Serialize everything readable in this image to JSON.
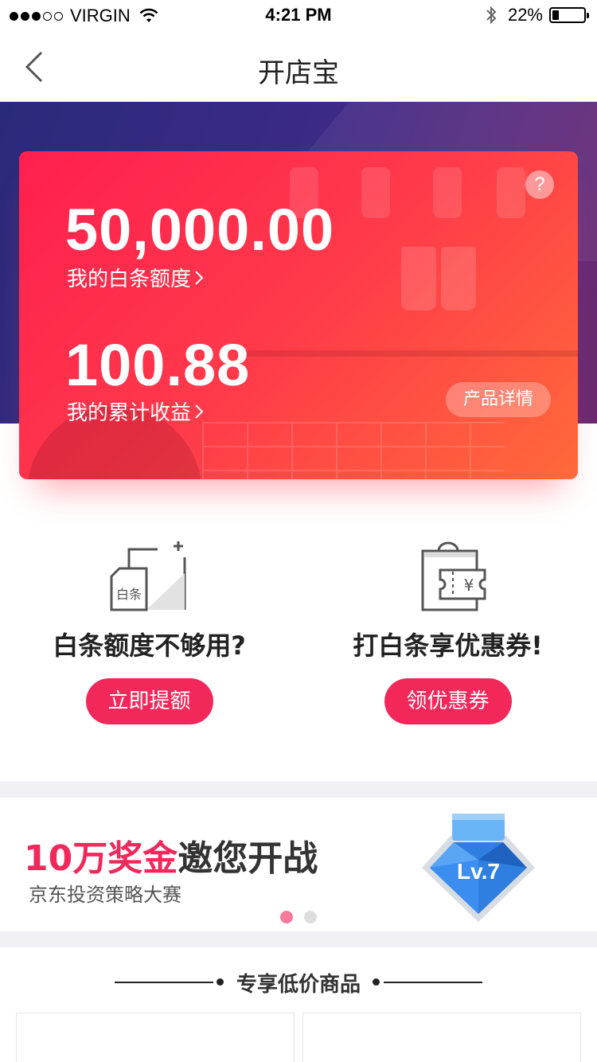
{
  "status_bar": {
    "carrier": "VIRGIN",
    "time": "4:21 PM",
    "battery": "22%",
    "icons": [
      "signal-dots-icon",
      "wifi-icon",
      "bluetooth-icon",
      "battery-icon"
    ]
  },
  "nav": {
    "title": "开店宝",
    "back_icon": "chevron-left-icon"
  },
  "card": {
    "credit_amount": "50,000.00",
    "credit_label": "我的白条额度",
    "earnings_amount": "100.88",
    "earnings_label": "我的累计收益",
    "help_label": "?",
    "detail_button": "产品详情"
  },
  "features": [
    {
      "icon": "credit-increase-icon",
      "icon_text": "白条",
      "title": "白条额度不够用?",
      "button": "立即提额"
    },
    {
      "icon": "coupon-bag-icon",
      "icon_text": "¥",
      "title": "打白条享优惠券!",
      "button": "领优惠券"
    }
  ],
  "banner": {
    "title_highlight": "10万奖金",
    "title_rest": "邀您开战",
    "subtitle": "京东投资策略大赛",
    "badge_text": "Lv.7",
    "badge_icon": "diamond-level-icon",
    "pages": 2,
    "active_page": 1
  },
  "section": {
    "title": "专享低价商品"
  },
  "colors": {
    "accent": "#f2275a",
    "card_gradient_start": "#ff1f4f",
    "card_gradient_end": "#ff6a3a",
    "hero_bg": "#2f2a7e"
  }
}
